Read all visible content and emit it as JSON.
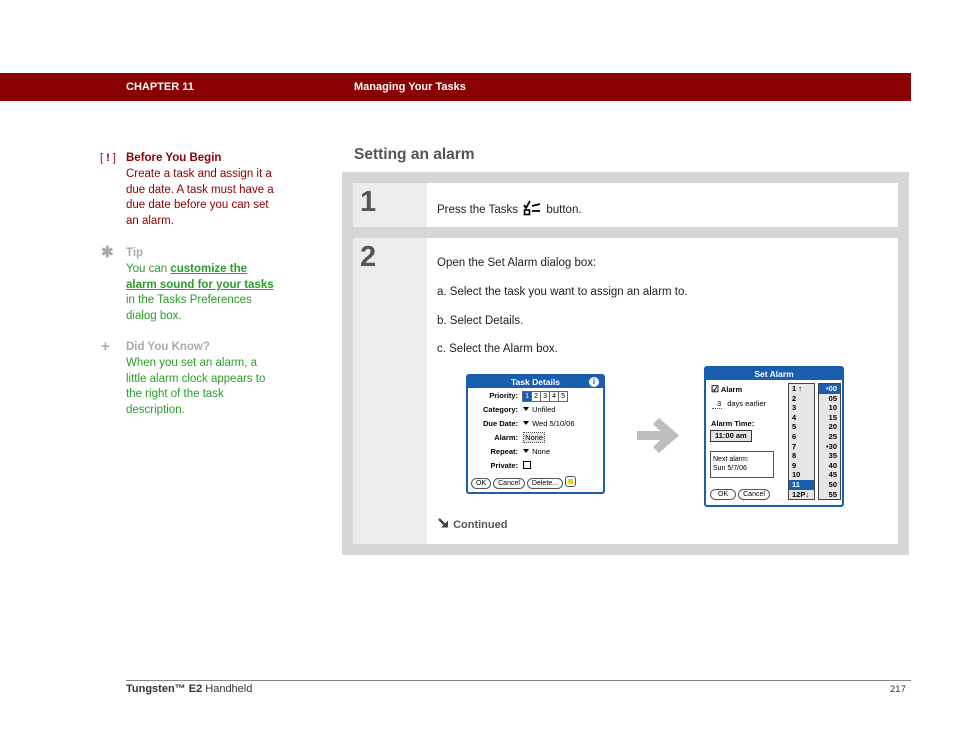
{
  "header": {
    "chapter": "CHAPTER 11",
    "title": "Managing Your Tasks",
    "band_color": "#8b0000"
  },
  "sidebar": {
    "before_you_begin": {
      "marker": "[ ! ]",
      "heading": "Before You Begin",
      "body": "Create a task and assign it a due date. A task must have a due date before you can set an alarm."
    },
    "tip": {
      "icon": "asterisk-icon",
      "heading": "Tip",
      "body_prefix": "You can ",
      "link": "customize the alarm sound for your tasks",
      "body_suffix": " in the Tasks Preferences dialog box."
    },
    "did_you_know": {
      "icon": "plus-icon",
      "heading": "Did You Know?",
      "body": "When you set an alarm, a little alarm clock appears to the right of the task description."
    }
  },
  "section": {
    "title": "Setting an alarm"
  },
  "steps": [
    {
      "number": "1",
      "text_before": "Press the Tasks",
      "icon": "tasks-button-icon",
      "text_after": "button."
    },
    {
      "number": "2",
      "intro": "Open the Set Alarm dialog box:",
      "substeps": [
        "a.  Select the task you want to assign an alarm to.",
        "b.  Select Details.",
        "c.  Select the Alarm box."
      ],
      "continued": "Continued"
    }
  ],
  "task_details_dialog": {
    "title": "Task Details",
    "priority_label": "Priority:",
    "priorities": [
      "1",
      "2",
      "3",
      "4",
      "5"
    ],
    "priority_selected": "1",
    "category_label": "Category:",
    "category_value": "Unfiled",
    "due_date_label": "Due Date:",
    "due_date_value": "Wed 5/10/06",
    "alarm_label": "Alarm:",
    "alarm_value": "None",
    "repeat_label": "Repeat:",
    "repeat_value": "None",
    "private_label": "Private:",
    "buttons": [
      "OK",
      "Cancel",
      "Delete..."
    ]
  },
  "set_alarm_dialog": {
    "title": "Set Alarm",
    "alarm_checkbox_label": "Alarm",
    "days_value": "3",
    "days_label": "days earlier",
    "alarm_time_label": "Alarm Time:",
    "alarm_time_value": "11:00 am",
    "next_alarm_label": "Next alarm:",
    "next_alarm_value": "Sun 5/7/06",
    "buttons": [
      "OK",
      "Cancel"
    ],
    "hours": [
      "1 ↑",
      "2",
      "3",
      "4",
      "5",
      "6",
      "7",
      "8",
      "9",
      "10",
      "11",
      "12P↓"
    ],
    "hour_selected": "11",
    "minutes": [
      "•00",
      "05",
      "10",
      "15",
      "20",
      "25",
      "•30",
      "35",
      "40",
      "45",
      "50",
      "55"
    ],
    "minute_selected": "•00"
  },
  "footer": {
    "product_brand": "Tungsten™ E2",
    "product_suffix": " Handheld",
    "page_number": "217"
  }
}
